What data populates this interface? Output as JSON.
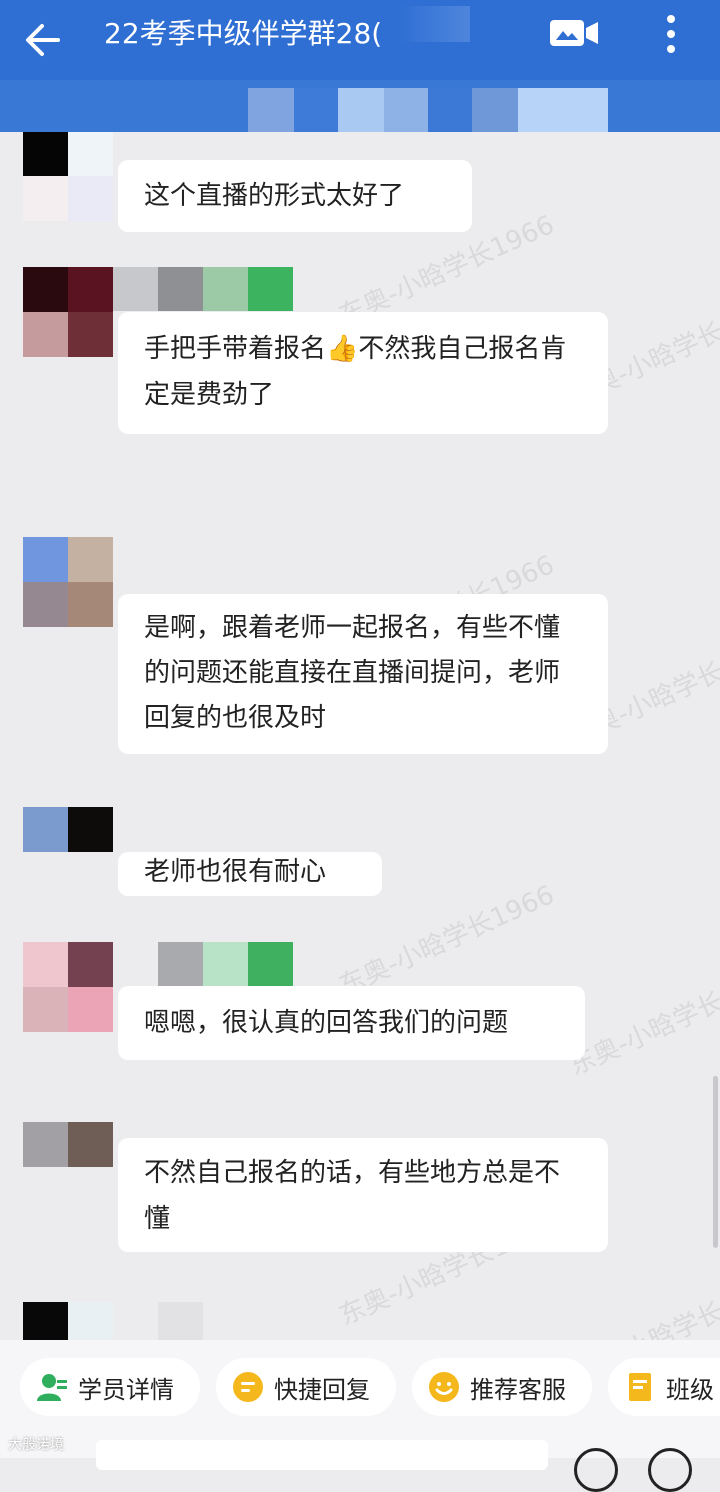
{
  "header": {
    "title": "22考季中级伴学群28(",
    "back_icon": "arrow-left-icon",
    "video_icon": "video-call-icon",
    "more_icon": "more-vertical-icon",
    "background": "#2f6fd3"
  },
  "messages": [
    {
      "text": "这个直播的形式太好了"
    },
    {
      "text": "手把手带着报名👍不然我自己报名肯定是费劲了"
    },
    {
      "text": "是啊，跟着老师一起报名，有些不懂的问题还能直接在直播间提问，老师回复的也很及时"
    },
    {
      "text": "老师也很有耐心"
    },
    {
      "text": "嗯嗯，很认真的回答我们的问题"
    },
    {
      "text": "不然自己报名的话，有些地方总是不懂"
    }
  ],
  "watermark": "东奥-小晗学长1966",
  "quick_replies": [
    {
      "label": "学员详情",
      "icon": "user-detail-icon",
      "color": "#2fae5e"
    },
    {
      "label": "快捷回复",
      "icon": "quick-reply-icon",
      "color": "#f5b81c"
    },
    {
      "label": "推荐客服",
      "icon": "service-icon",
      "color": "#f5b81c"
    },
    {
      "label": "班级",
      "icon": "class-icon",
      "color": "#f5b81c"
    }
  ],
  "bottom_watermark": "大般诺境"
}
